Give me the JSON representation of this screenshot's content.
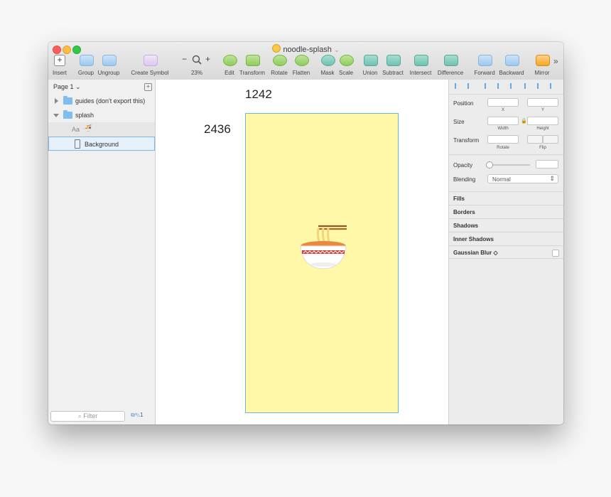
{
  "window": {
    "title": "noodle-splash"
  },
  "toolbar": {
    "insert": "Insert",
    "group": "Group",
    "ungroup": "Ungroup",
    "create_symbol": "Create Symbol",
    "zoom": "23%",
    "edit": "Edit",
    "transform": "Transform",
    "rotate": "Rotate",
    "flatten": "Flatten",
    "mask": "Mask",
    "scale": "Scale",
    "union": "Union",
    "subtract": "Subtract",
    "intersect": "Intersect",
    "difference": "Difference",
    "forward": "Forward",
    "backward": "Backward",
    "mirror": "Mirror",
    "overflow": "»"
  },
  "sidebar": {
    "page": "Page 1 ⌄",
    "layers": [
      {
        "label": "guides (don't export this)"
      },
      {
        "label": "splash"
      },
      {
        "label": "Aa"
      },
      {
        "label": "Background"
      }
    ],
    "filter_placeholder": "Filter",
    "bottom_count": "1"
  },
  "canvas": {
    "width_label": "1242",
    "height_label": "2436",
    "artboard_color": "#fff8a8"
  },
  "inspector": {
    "position": "Position",
    "x": "X",
    "y": "Y",
    "size": "Size",
    "width": "Width",
    "height": "Height",
    "transform": "Transform",
    "rotate": "Rotate",
    "flip": "Flip",
    "opacity": "Opacity",
    "blending": "Blending",
    "blending_value": "Normal",
    "fills": "Fills",
    "borders": "Borders",
    "shadows": "Shadows",
    "inner_shadows": "Inner Shadows",
    "gaussian_blur": "Gaussian Blur ◇"
  }
}
